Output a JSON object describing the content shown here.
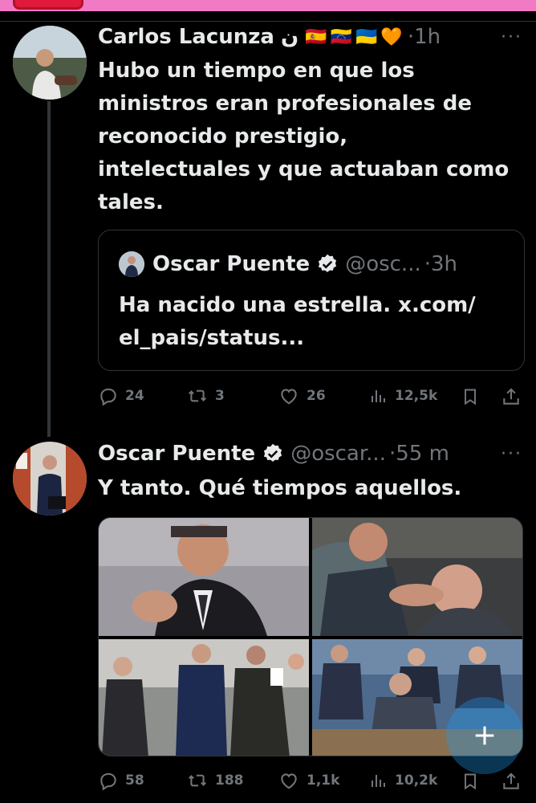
{
  "tweet1": {
    "name": "Carlos Lacunza",
    "name_symbol": "ن",
    "flags": [
      "🇪🇸",
      "🇻🇪",
      "🇺🇦",
      "🧡"
    ],
    "time": "·1h",
    "text_lines": [
      "Hubo un tiempo en que los",
      "ministros eran profesionales de",
      "reconocido prestigio,",
      "intelectuales y que actuaban como",
      "tales."
    ],
    "quote": {
      "name": "Oscar Puente",
      "handle": "@osc...",
      "time": "·3h",
      "text_lines": [
        "Ha nacido una estrella. x.com/",
        "el_pais/status..."
      ]
    },
    "actions": {
      "replies": "24",
      "reposts": "3",
      "likes": "26",
      "views": "12,5k"
    }
  },
  "tweet2": {
    "name": "Oscar Puente",
    "handle": "@oscar...",
    "time": "·55 m",
    "text": "Y tanto. Qué tiempos aquellos.",
    "actions": {
      "replies": "58",
      "reposts": "188",
      "likes": "1,1k",
      "views": "10,2k"
    }
  },
  "more_label": "···",
  "colors": {
    "background": "#000000",
    "text": "#e7e9ea",
    "muted": "#71767b",
    "border": "#2f3336",
    "verified": "#e7e9ea",
    "banner": "#f07ac4",
    "fab": "#1d9bf0"
  },
  "icons": [
    "reply-icon",
    "repost-icon",
    "like-icon",
    "views-icon",
    "bookmark-icon",
    "share-icon",
    "verified-badge-icon",
    "compose-icon",
    "more-icon"
  ]
}
